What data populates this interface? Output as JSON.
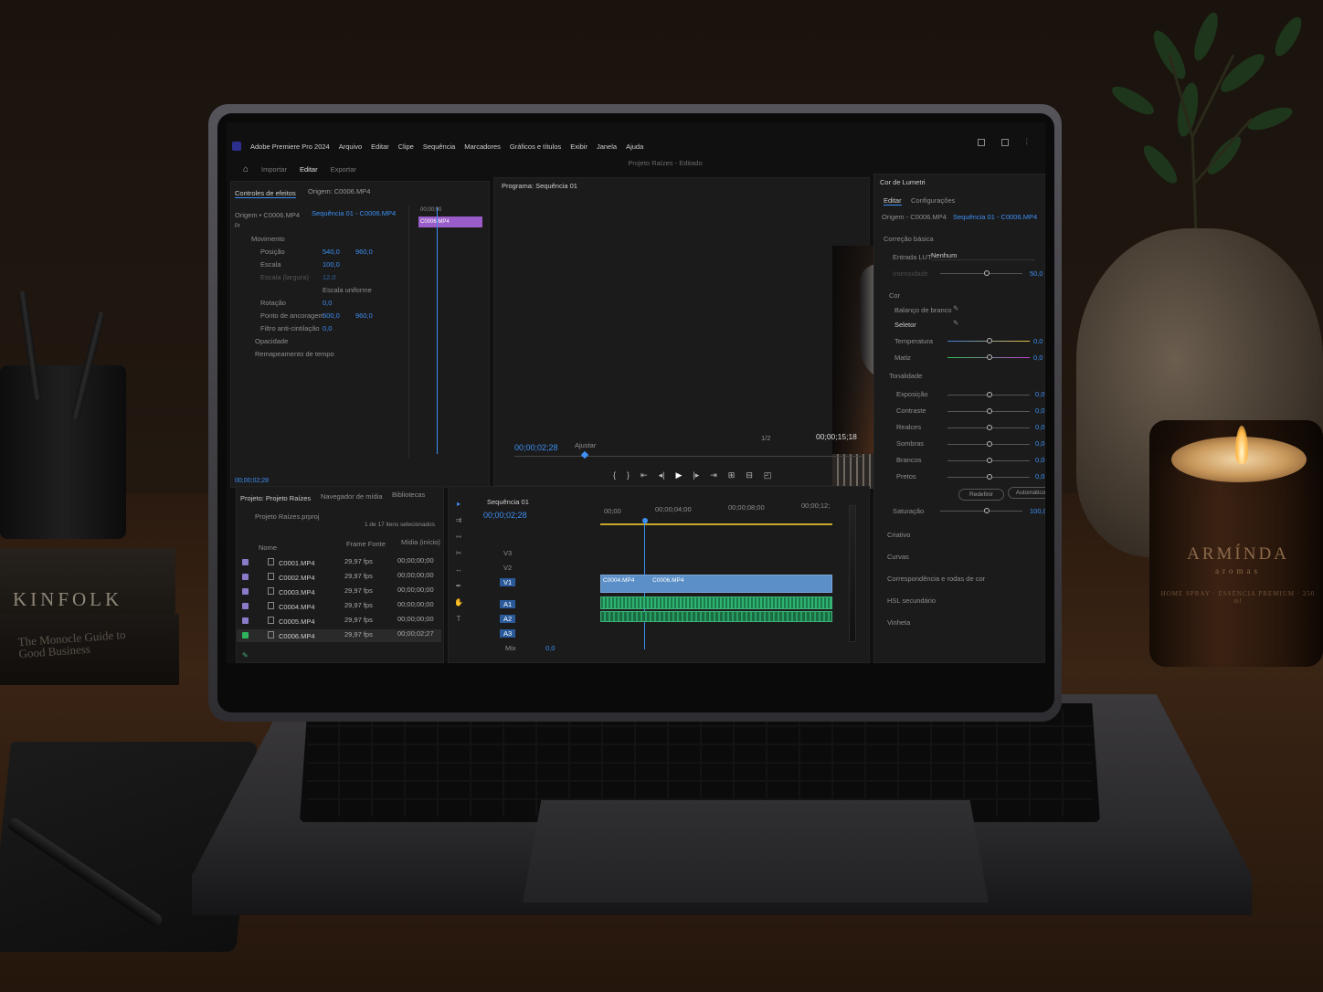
{
  "window": {
    "app_name": "Adobe Premiere Pro 2024",
    "menu": [
      "Arquivo",
      "Editar",
      "Clipe",
      "Sequência",
      "Marcadores",
      "Gráficos e títulos",
      "Exibir",
      "Janela",
      "Ajuda"
    ],
    "workspace_tabs": [
      "Importar",
      "Editar",
      "Exportar"
    ],
    "project_title": "Projeto Raízes - Editado"
  },
  "effect_controls": {
    "tab": "Controles de efeitos",
    "source_tab": "Origem: C0006.MP4",
    "source": "Origem • C0006.MP4",
    "sequence": "Sequência 01 - C0006.MP4",
    "mini_clip": "C0006.MP4",
    "mini_tc": "00;00;00",
    "fx_label": "Pr",
    "motion": "Movimento",
    "position": {
      "label": "Posição",
      "x": "540,0",
      "y": "960,0"
    },
    "scale": {
      "label": "Escala",
      "value": "100,0"
    },
    "scale_width": {
      "label": "Escala (largura)",
      "value": "12,0"
    },
    "uniform": "Escala uniforme",
    "rotation": {
      "label": "Rotação",
      "value": "0,0"
    },
    "anchor": {
      "label": "Ponto de ancoragem",
      "x": "500,0",
      "y": "960,0"
    },
    "antiflicker": {
      "label": "Filtro anti-cintilação",
      "value": "0,0"
    },
    "opacity": "Opacidade",
    "time_remap": "Remapeamento de tempo",
    "timecode": "00;00;02;28"
  },
  "program": {
    "tab": "Programa: Sequência 01",
    "timecode": "00;00;02;28",
    "fit": "Ajustar",
    "quality": "1/2",
    "duration": "00;00;15;18"
  },
  "project": {
    "tabs": [
      "Projeto: Projeto Raízes",
      "Navegador de mídia",
      "Bibliotecas"
    ],
    "file": "Projeto Raízes.prproj",
    "selected": "1 de 17 itens selecionados",
    "columns": [
      "Nome",
      "Frame Fonte",
      "Mídia (início)"
    ],
    "rows": [
      {
        "name": "C0001.MP4",
        "fps": "29,97 fps",
        "tc": "00;00;00;00",
        "color": "#8a7ac8"
      },
      {
        "name": "C0002.MP4",
        "fps": "29,97 fps",
        "tc": "00;00;00;00",
        "color": "#8a7ac8"
      },
      {
        "name": "C0003.MP4",
        "fps": "29,97 fps",
        "tc": "00;00;00;00",
        "color": "#8a7ac8"
      },
      {
        "name": "C0004.MP4",
        "fps": "29,97 fps",
        "tc": "00;00;00;00",
        "color": "#8a7ac8"
      },
      {
        "name": "C0005.MP4",
        "fps": "29,97 fps",
        "tc": "00;00;00;00",
        "color": "#8a7ac8"
      },
      {
        "name": "C0006.MP4",
        "fps": "29,97 fps",
        "tc": "00;00;02;27",
        "color": "#2fb35c"
      }
    ]
  },
  "timeline": {
    "tab": "Sequência 01",
    "timecode": "00;00;02;28",
    "ruler": [
      "00;00",
      "00;00;04;00",
      "00;00;08;00",
      "00;00;12;"
    ],
    "tracks": [
      "V3",
      "V2",
      "V1",
      "A1",
      "A2",
      "A3"
    ],
    "mix": "Mix",
    "mix_value": "0,0",
    "clips": [
      "C0004.MP4",
      "C0006.MP4"
    ]
  },
  "lumetri": {
    "tab": "Cor de Lumetri",
    "subtabs": [
      "Editar",
      "Configurações"
    ],
    "source": "Origem - C0006.MP4",
    "sequence": "Sequência 01 - C0006.MP4",
    "basic": "Correção básica",
    "lut_label": "Entrada LUT",
    "lut_value": "Nenhum",
    "intensity": {
      "label": "Intensidade",
      "value": "50,0"
    },
    "color": "Cor",
    "white_balance": "Balanço de branco",
    "selector": "Seletor",
    "temperature": {
      "label": "Temperatura",
      "value": "0,0"
    },
    "tint": {
      "label": "Matiz",
      "value": "0,0"
    },
    "tone": "Tonalidade",
    "tone_rows": [
      {
        "label": "Exposição",
        "value": "0,0"
      },
      {
        "label": "Contraste",
        "value": "0,0"
      },
      {
        "label": "Realces",
        "value": "0,0"
      },
      {
        "label": "Sombras",
        "value": "0,0"
      },
      {
        "label": "Brancos",
        "value": "0,0"
      },
      {
        "label": "Pretos",
        "value": "0,0"
      }
    ],
    "reset": "Redefinir",
    "auto": "Automático",
    "saturation": {
      "label": "Saturação",
      "value": "100,0"
    },
    "sections": [
      "Criativo",
      "Curvas",
      "Correspondência e rodas de cor",
      "HSL secundário",
      "Vinheta"
    ]
  },
  "scene": {
    "book1": "KINFOLK",
    "book2": "The Monocle Guide to Good Business",
    "candle_brand": "ARMÍNDA",
    "candle_sub": "aromas",
    "candle_meta": "HOME SPRAY · ESSÊNCIA PREMIUM · 250 ml"
  }
}
